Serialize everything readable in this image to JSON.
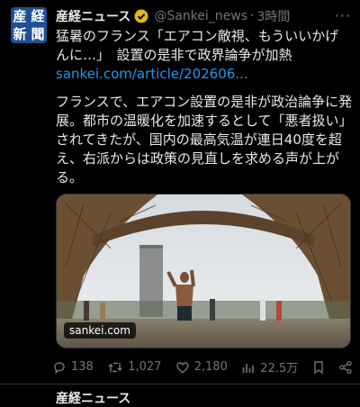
{
  "account": {
    "avatar_chars": [
      "産",
      "経",
      "新",
      "聞"
    ],
    "name": "産経ニュース",
    "handle": "@Sankei_news",
    "separator": "·",
    "time": "3時間"
  },
  "post": {
    "line1": "猛暑のフランス「エアコン敵視、もういいかげ",
    "line2": "んに…」　設置の是非で政界論争が加熱",
    "link": "sankei.com/article/202606...",
    "body": "フランスで、エアコン設置の是非が政治論争に発展。都市の温暖化を加速するとして「悪者扱い」されてきたが、国内の最高気温が連日40度を超え、右派からは政策の見直しを求める声が上がる。",
    "media_source": "sankei.com"
  },
  "stats": {
    "replies": "138",
    "retweets": "1,027",
    "likes": "2,180",
    "views": "22.5万"
  },
  "next_post": {
    "name": "産経ニュース"
  },
  "colors": {
    "background": "#000000",
    "text": "#e7e9ea",
    "muted": "#71767b",
    "link": "#1d9bf0",
    "verified": "#e2b719"
  }
}
